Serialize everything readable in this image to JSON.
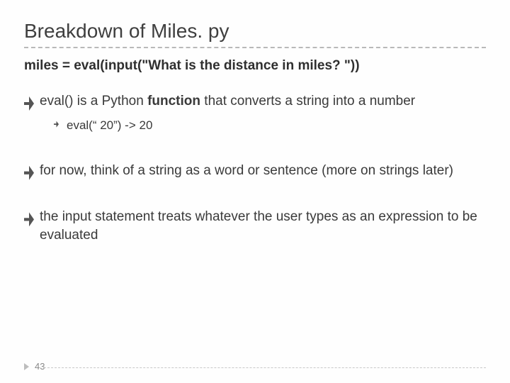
{
  "title": "Breakdown of Miles. py",
  "codeline": "miles = eval(input(\"What is the distance in miles? \"))",
  "bullets": [
    {
      "pre": "eval() is a Python ",
      "bold": "function",
      "post": " that converts a string into a number",
      "sub": [
        "eval(“ 20”) -> 20"
      ]
    },
    {
      "pre": "for now, think of a string as a word or sentence (more on strings later)",
      "bold": "",
      "post": ""
    },
    {
      "pre": "the input statement treats whatever the user types as an expression to be evaluated",
      "bold": "",
      "post": ""
    }
  ],
  "page_number": "43"
}
